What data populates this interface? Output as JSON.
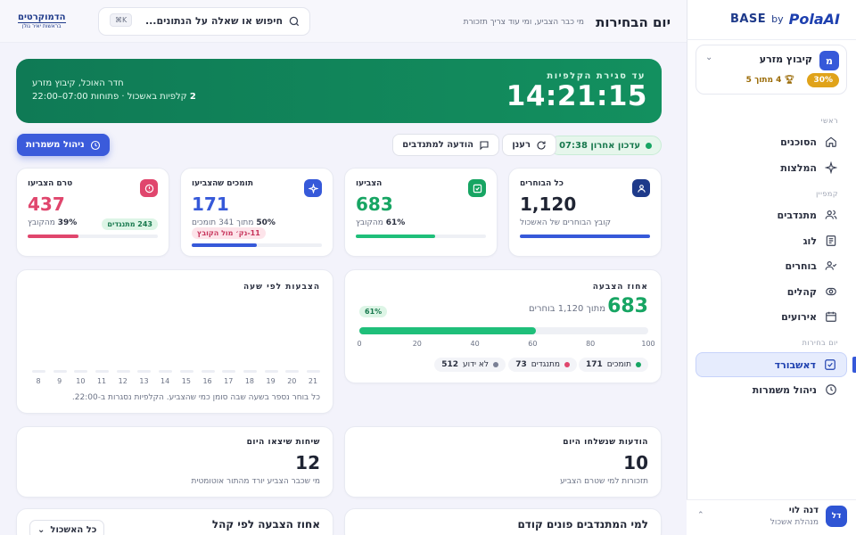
{
  "brand": {
    "base": "BASE",
    "by": "by",
    "polaai": "PolaAI"
  },
  "kibbutz": {
    "avatar": "מ",
    "name": "קיבוץ מזרע",
    "percent": "30%",
    "rank": "4 מתוך 5"
  },
  "nav": {
    "sec_general": "ראשי",
    "sec_campaign": "קמפיין",
    "sec_electionday": "יום בחירות",
    "items": [
      {
        "label": "הסוכנים",
        "icon": "home-icon"
      },
      {
        "label": "המלצות",
        "icon": "sparkle-icon"
      },
      {
        "label": "מתנדבים",
        "icon": "users-icon"
      },
      {
        "label": "לוג",
        "icon": "log-icon"
      },
      {
        "label": "בוחרים",
        "icon": "user-check-icon"
      },
      {
        "label": "קהלים",
        "icon": "audience-icon"
      },
      {
        "label": "אירועים",
        "icon": "calendar-icon"
      },
      {
        "label": "דאשבורד",
        "icon": "checkbox-icon"
      },
      {
        "label": "ניהול משמרות",
        "icon": "clock-icon"
      }
    ]
  },
  "user": {
    "initials": "דל",
    "name": "דנה לוי",
    "role": "מנהלת אשכול"
  },
  "topbar": {
    "title": "יום הבחירות",
    "subtitle": "מי כבר הצביע, ומי עוד צריך תזכורת",
    "search_placeholder": "חיפוש או שאלה על הנתונים...",
    "shortcut": "⌘K",
    "logo_line1": "הדמוקרטים",
    "logo_line2": "בראשות יאיר גולן"
  },
  "hero": {
    "label": "עד סגירת הקלפיות",
    "time": "14:21:15",
    "location": "חדר האוכל, קיבוץ מזרע",
    "ballots_count": "2",
    "ballots_text": "קלפיות באשכול · פתוחות 07:00–22:00"
  },
  "actions": {
    "last_update": "עדכון אחרון 07:38",
    "refresh": "רענן",
    "message": "הודעה למתנדבים",
    "shifts": "ניהול משמרות"
  },
  "kpis": [
    {
      "title": "כל הבוחרים",
      "value": "1,120",
      "sub": "קובץ הבוחרים של האשכול",
      "color": "#1e3a8a",
      "bar_pct": 100,
      "bar_color": "#3659d9",
      "icon": "person-icon"
    },
    {
      "title": "הצביעו",
      "value": "683",
      "sub_bold": "61%",
      "sub": "מהקובץ",
      "color": "#17a563",
      "bar_pct": 61,
      "bar_color": "#1fbf7a",
      "icon": "checkbox-icon"
    },
    {
      "title": "תומכים שהצביעו",
      "value": "171",
      "sub_bold": "50%",
      "sub": "מתוך 341 תומכים",
      "chip": "11-נק׳ מול הקובץ",
      "color": "#3659d9",
      "bar_pct": 50,
      "bar_color": "#3659d9",
      "icon": "sparkle-icon"
    },
    {
      "title": "טרם הצביעו",
      "value": "437",
      "sub_bold": "39%",
      "sub": "מהקובץ",
      "chip": "243 מתנגדים",
      "color": "#e0466d",
      "bar_pct": 39,
      "bar_color": "#e0466d",
      "icon": "alert-icon"
    }
  ],
  "turnout": {
    "title": "אחוז הצבעה",
    "value": "683",
    "sub": "מתוך 1,120 בוחרים",
    "pct_label": "61%",
    "pct": 61,
    "ticks": [
      "0",
      "20",
      "40",
      "60",
      "80",
      "100"
    ],
    "legend": [
      {
        "label": "תומכים",
        "count": "171",
        "color": "#17a563"
      },
      {
        "label": "מתנגדים",
        "count": "73",
        "color": "#e0466d"
      },
      {
        "label": "לא ידוע",
        "count": "512",
        "color": "#7a8095"
      }
    ]
  },
  "hourly": {
    "title": "הצבעות לפי שעה",
    "hours": [
      "8",
      "9",
      "10",
      "11",
      "12",
      "13",
      "14",
      "15",
      "16",
      "17",
      "18",
      "19",
      "20",
      "21"
    ],
    "note": "כל בוחר נספר בשעה שבה סומן כמי שהצביע. הקלפיות נסגרות ב-22:00."
  },
  "messages_today": {
    "title": "הודעות שנשלחו היום",
    "value": "10",
    "sub": "תזכורות למי שטרם הצביע"
  },
  "calls_today": {
    "title": "שיחות שיצאו היום",
    "value": "12",
    "sub": "מי שכבר הצביע יורד מהתור אוטומטית"
  },
  "bottom": {
    "volunteers_title": "למי המתנדבים פונים קודם",
    "by_audience_title": "אחוז הצבעה לפי קהל",
    "dropdown": "כל האשכול"
  }
}
